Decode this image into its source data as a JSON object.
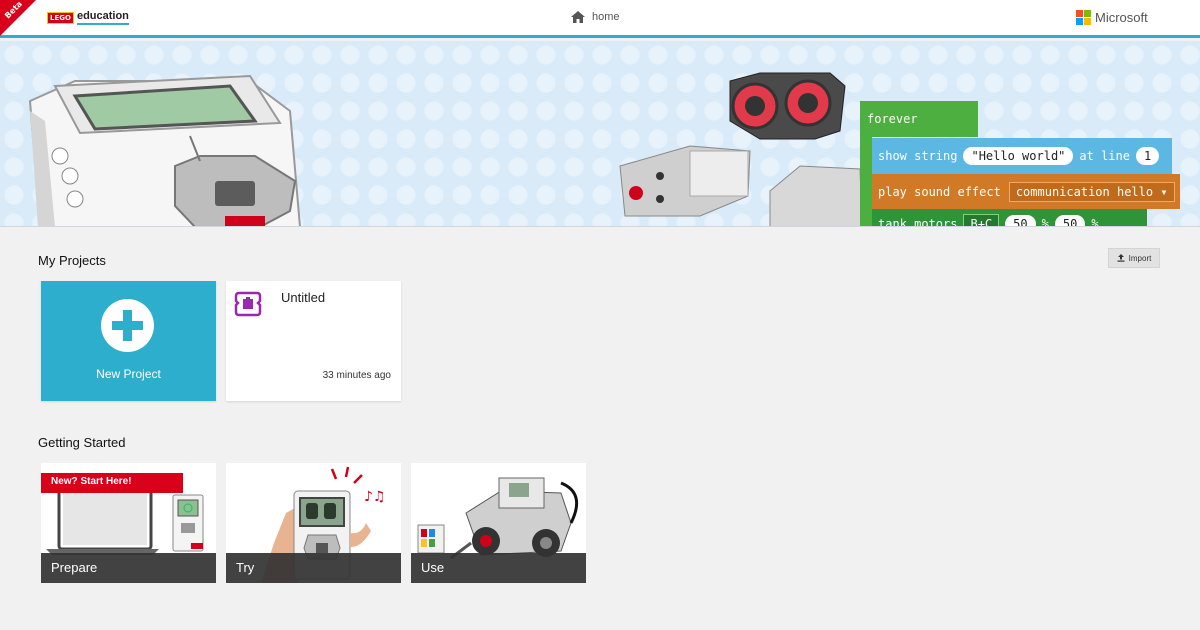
{
  "header": {
    "beta": "Beta",
    "brand_badge": "LEGO",
    "brand_word": "education",
    "home_label": "home",
    "partner": "Microsoft"
  },
  "hero": {
    "blocks": {
      "forever": "forever",
      "show_string": "show string",
      "hello": "\"Hello world\"",
      "at_line": "at line",
      "line_num": "1",
      "play_sound": "play sound effect",
      "sound_value": "communication hello",
      "tank": "tank motors",
      "tank_port": "B+C",
      "tank_v1": "50",
      "tank_pct1": "%",
      "tank_v2": "50",
      "tank_pct2": "%"
    }
  },
  "projects": {
    "title": "My Projects",
    "import_label": "Import",
    "new_label": "New Project",
    "items": [
      {
        "title": "Untitled",
        "time": "33 minutes ago"
      }
    ]
  },
  "getting_started": {
    "title": "Getting Started",
    "ribbon": "New? Start Here!",
    "cards": [
      {
        "label": "Prepare"
      },
      {
        "label": "Try"
      },
      {
        "label": "Use"
      }
    ]
  },
  "colors": {
    "accent": "#2eaecd",
    "brand_red": "#d9001b",
    "block_green": "#4caf3f",
    "block_blue": "#5cb8e2",
    "block_orange": "#d07a28"
  }
}
